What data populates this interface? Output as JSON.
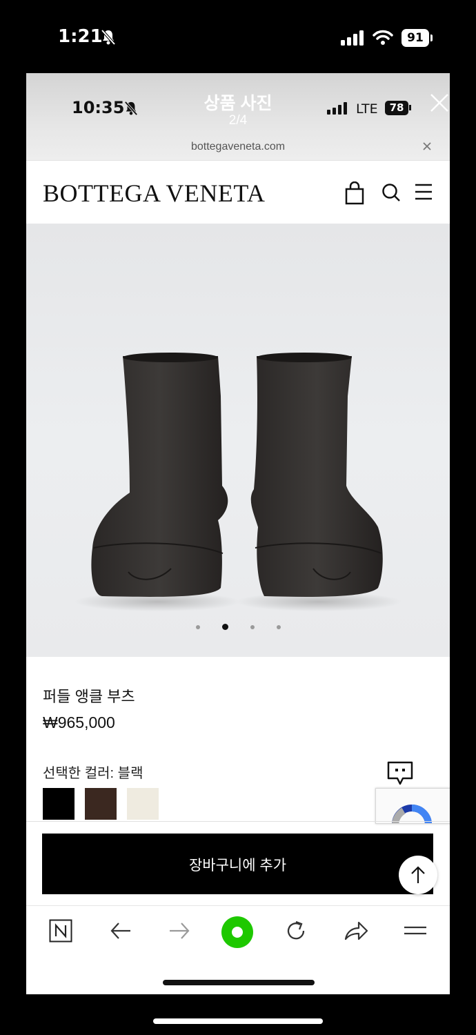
{
  "outer_status": {
    "time": "1:21",
    "battery": "91"
  },
  "viewer": {
    "title": "상품 사진",
    "counter": "2/4"
  },
  "inner_status": {
    "time": "10:35",
    "network": "LTE",
    "battery": "78"
  },
  "browser": {
    "url": "bottegaveneta.com"
  },
  "site": {
    "logo": "BOTTEGA VENETA"
  },
  "product": {
    "name": "퍼들 앵클 부츠",
    "price": "₩965,000",
    "selected_color": "선택한 컬러: 블랙",
    "swatches": [
      {
        "name": "black",
        "color": "#000000"
      },
      {
        "name": "brown",
        "color": "#3b2820"
      },
      {
        "name": "cream",
        "color": "#efebe0"
      }
    ],
    "carousel": {
      "total": 4,
      "active": 2
    }
  },
  "cta": {
    "add_to_cart": "장바구니에 추가"
  },
  "icons": {
    "accent_green": "#1ec800",
    "bottom_nav": [
      "naver-n-icon",
      "back-arrow-icon",
      "forward-arrow-icon",
      "naver-green-dot-icon",
      "reload-icon",
      "share-icon",
      "menu-lines-icon"
    ]
  }
}
